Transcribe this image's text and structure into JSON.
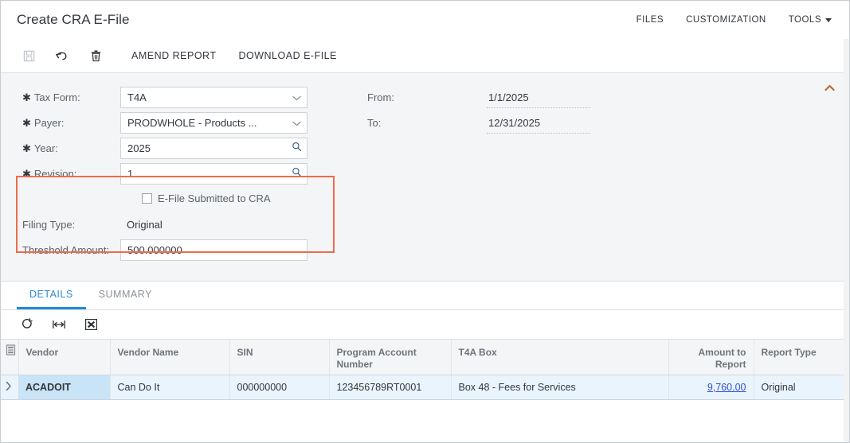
{
  "header": {
    "title": "Create CRA E-File",
    "menus": [
      {
        "label": "FILES",
        "name": "files"
      },
      {
        "label": "CUSTOMIZATION",
        "name": "customization"
      },
      {
        "label": "TOOLS",
        "name": "tools"
      }
    ]
  },
  "toolbar": {
    "save_icon": "save-icon",
    "undo_icon": "undo-icon",
    "delete_icon": "trash-icon",
    "amend_label": "AMEND REPORT",
    "download_label": "DOWNLOAD E-FILE"
  },
  "form": {
    "collapse_icon": "chevron-up-icon",
    "highlight_color": "#ef6a4b",
    "tax_form": {
      "label": "Tax Form:",
      "value": "T4A",
      "required": true,
      "control": "dropdown"
    },
    "payer": {
      "label": "Payer:",
      "value": "PRODWHOLE - Products ...",
      "required": true,
      "control": "dropdown"
    },
    "year": {
      "label": "Year:",
      "value": "2025",
      "required": true,
      "control": "selector"
    },
    "revision": {
      "label": "Revision:",
      "value": "1",
      "required": true,
      "control": "selector"
    },
    "efile_submitted": {
      "label": "E-File Submitted to CRA",
      "checked": false
    },
    "filing_type": {
      "label": "Filing Type:",
      "value": "Original"
    },
    "threshold_amount": {
      "label": "Threshold Amount:",
      "value": "500.000000"
    },
    "from": {
      "label": "From:",
      "value": "1/1/2025"
    },
    "to": {
      "label": "To:",
      "value": "12/31/2025"
    }
  },
  "tabs": [
    {
      "label": "DETAILS",
      "active": true
    },
    {
      "label": "SUMMARY",
      "active": false
    }
  ],
  "grid_toolbar": {
    "refresh_icon": "refresh-icon",
    "fit_icon": "fit-columns-icon",
    "export_icon": "export-excel-icon"
  },
  "grid": {
    "selector_icon": "column-config-icon",
    "columns": [
      {
        "label": "Vendor",
        "align": "left"
      },
      {
        "label": "Vendor Name",
        "align": "left"
      },
      {
        "label": "SIN",
        "align": "left"
      },
      {
        "label": "Program Account Number",
        "align": "left"
      },
      {
        "label": "T4A Box",
        "align": "left"
      },
      {
        "label": "Amount to Report",
        "align": "right"
      },
      {
        "label": "Report Type",
        "align": "left"
      }
    ],
    "rows": [
      {
        "row_icon": "row-expand-icon",
        "vendor": "ACADOIT",
        "vendor_name": "Can Do It",
        "sin": "000000000",
        "program_account_number": "123456789RT0001",
        "t4a_box": "Box 48 - Fees for Services",
        "amount_to_report": "9,760.00",
        "report_type": "Original"
      }
    ]
  }
}
